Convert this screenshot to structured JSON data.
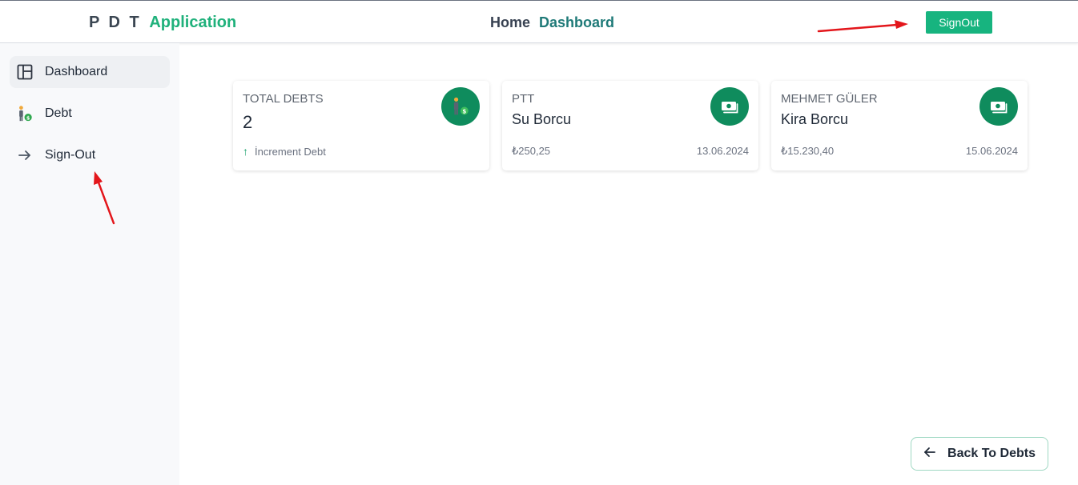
{
  "header": {
    "brand_prefix": "P D T",
    "brand_suffix": "Application",
    "nav_home": "Home",
    "nav_current": "Dashboard",
    "signout_label": "SignOut"
  },
  "sidebar": {
    "items": [
      {
        "label": "Dashboard",
        "icon": "layout-icon",
        "active": true
      },
      {
        "label": "Debt",
        "icon": "person-money-icon",
        "active": false
      },
      {
        "label": "Sign-Out",
        "icon": "arrow-right-icon",
        "active": false
      }
    ]
  },
  "cards": [
    {
      "label": "TOTAL DEBTS",
      "value": "2",
      "footer_left": "İncrement Debt",
      "footer_right": "",
      "icon": "person-money-icon"
    },
    {
      "label": "PTT",
      "value": "Su Borcu",
      "footer_left": "₺250,25",
      "footer_right": "13.06.2024",
      "icon": "banknote-icon"
    },
    {
      "label": "MEHMET GÜLER",
      "value": "Kira Borcu",
      "footer_left": "₺15.230,40",
      "footer_right": "15.06.2024",
      "icon": "banknote-icon"
    }
  ],
  "back_button": {
    "label": "Back To Debts",
    "icon": "arrow-left-icon"
  },
  "colors": {
    "accent": "#17b47f",
    "card_icon_bg": "#0f8c5d",
    "annotation": "#e3161b"
  }
}
